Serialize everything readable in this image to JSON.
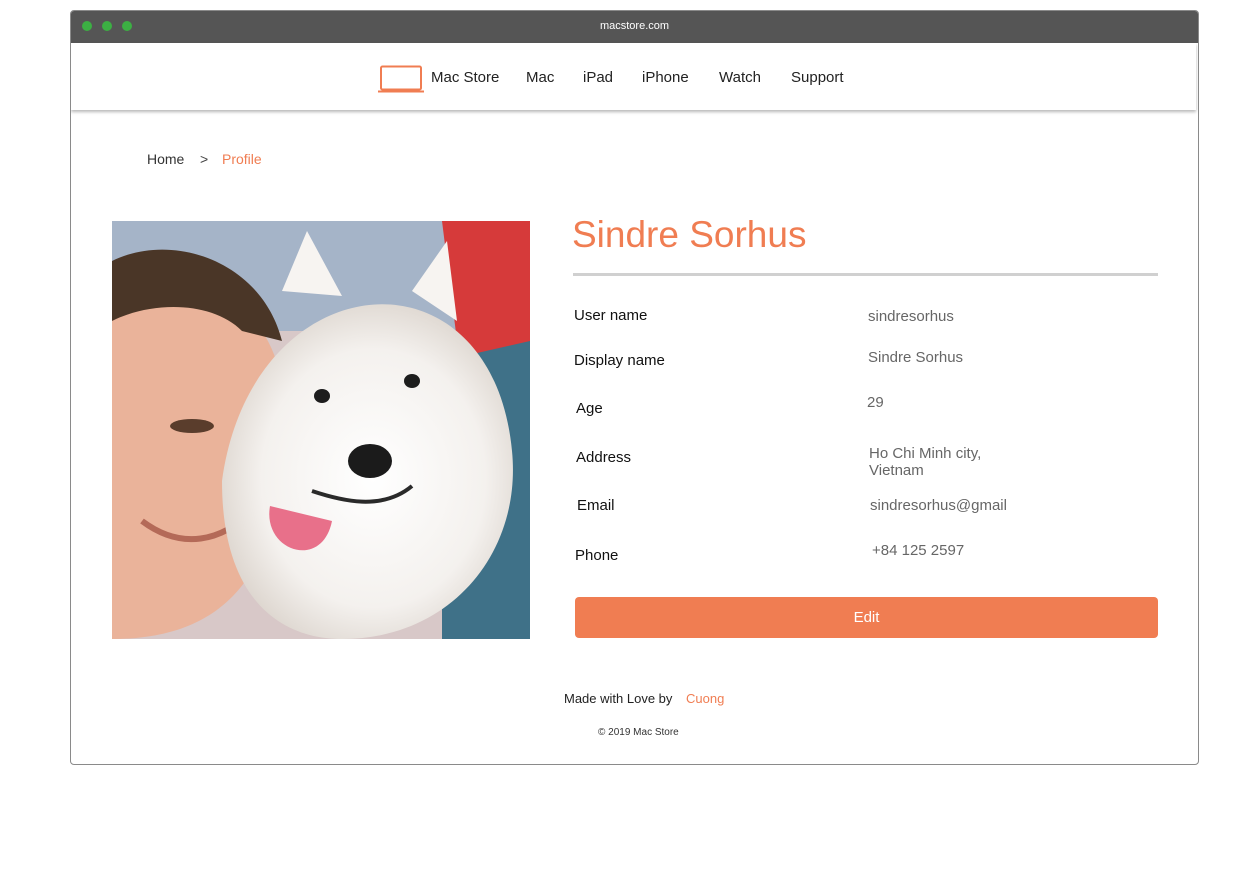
{
  "window": {
    "url": "macstore.com"
  },
  "nav": {
    "brand": "Mac Store",
    "items": [
      "Mac",
      "iPad",
      "iPhone",
      "Watch",
      "Support"
    ]
  },
  "breadcrumb": {
    "home": "Home",
    "separator": ">",
    "current": "Profile"
  },
  "profile": {
    "name": "Sindre Sorhus",
    "photo_description_icon": "person-with-white-dog-photo",
    "fields": {
      "username": {
        "label": "User name",
        "value": "sindresorhus"
      },
      "display_name": {
        "label": "Display name",
        "value": "Sindre Sorhus"
      },
      "age": {
        "label": "Age",
        "value": "29"
      },
      "address": {
        "label": "Address",
        "value_line1": "Ho Chi Minh city,",
        "value_line2": "Vietnam"
      },
      "email": {
        "label": "Email",
        "value": "sindresorhus@gmail"
      },
      "phone": {
        "label": "Phone",
        "value": "+84 125 2597"
      }
    },
    "edit_label": "Edit"
  },
  "footer": {
    "made_with": "Made with Love by",
    "author": "Cuong",
    "copyright": "© 2019 Mac Store"
  },
  "colors": {
    "accent": "#f07d52",
    "titlebar": "#555555",
    "traffic_light": "#3cb043",
    "divider": "#d0d0d0"
  }
}
